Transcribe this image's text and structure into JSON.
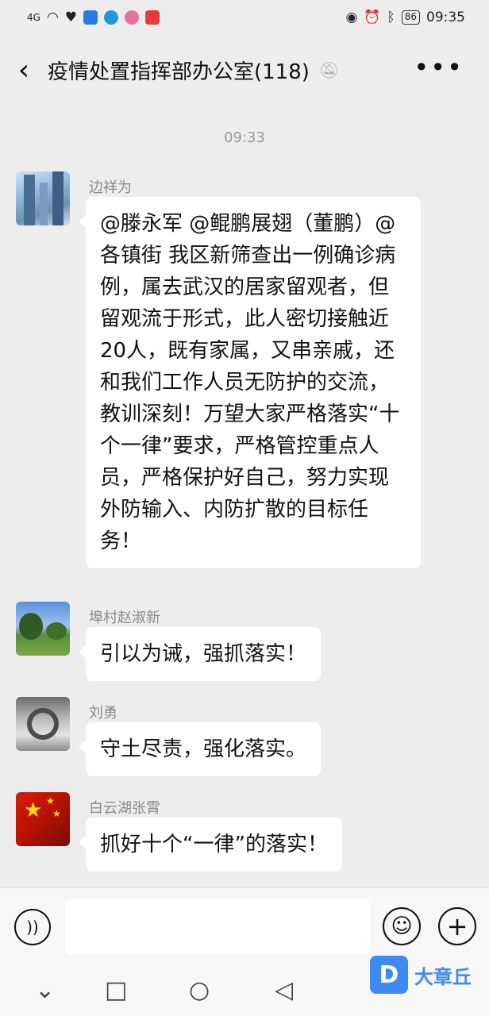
{
  "status_bar": {
    "signal": "4G",
    "battery": "86",
    "time": "09:35"
  },
  "header": {
    "back_icon": "chevron-left-icon",
    "title": "疫情处置指挥部办公室(118)",
    "mute_icon": "bell-off-icon",
    "more_icon": "more-dots-icon"
  },
  "timestamp": "09:33",
  "messages": [
    {
      "sender": "边祥为",
      "text": "@滕永军 @鲲鹏展翅（董鹏）@各镇街 我区新筛查出一例确诊病例，属去武汉的居家留观者，但留观流于形式，此人密切接触近20人，既有家属，又串亲戚，还和我们工作人员无防护的交流，教训深刻！万望大家严格落实“十个一律”要求，严格管控重点人员，严格保护好自己，努力实现外防输入、内防扩散的目标任务！"
    },
    {
      "sender": "埠村赵淑新",
      "text": "引以为诫，强抓落实！"
    },
    {
      "sender": "刘勇",
      "text": "守土尽责，强化落实。"
    },
    {
      "sender": "白云湖张霄",
      "text": "抓好十个“一律”的落实！"
    }
  ],
  "input_bar": {
    "voice_icon": "voice-icon",
    "emoji_icon": "emoji-icon",
    "plus_icon": "plus-icon"
  },
  "watermark": {
    "text": "大章丘"
  }
}
